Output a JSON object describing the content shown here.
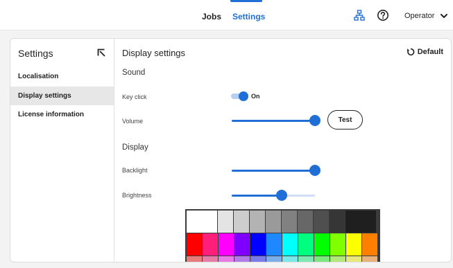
{
  "header": {
    "tabs": [
      {
        "label": "Jobs",
        "active": false
      },
      {
        "label": "Settings",
        "active": true
      }
    ],
    "icons": {
      "network": "network-icon",
      "help": "help-icon",
      "menu": "chevron-down-icon"
    },
    "user": "Operator"
  },
  "sidebar": {
    "title": "Settings",
    "collapse_icon": "collapse-arrow-icon",
    "items": [
      {
        "label": "Localisation",
        "active": false
      },
      {
        "label": "Display settings",
        "active": true
      },
      {
        "label": "License information",
        "active": false
      }
    ]
  },
  "main": {
    "title": "Display settings",
    "default_label": "Default",
    "default_icon": "reset-icon",
    "sound": {
      "heading": "Sound",
      "key_click_label": "Key click",
      "key_click_state": "On",
      "key_click_on": true,
      "volume_label": "Volume",
      "volume_fraction": 1.0,
      "test_label": "Test"
    },
    "display": {
      "heading": "Display",
      "backlight_label": "Backlight",
      "backlight_fraction": 1.0,
      "brightness_label": "Brightness",
      "brightness_fraction": 0.6
    },
    "palette": {
      "gray_row": [
        "#ffffff",
        "#e4e4e4",
        "#cdcdcd",
        "#b3b3b3",
        "#9a9a9a",
        "#818181",
        "#676767",
        "#4f4f4f",
        "#363636",
        "#1f1f1f"
      ],
      "color_row": [
        "#ff0000",
        "#ff1f7a",
        "#ff00ff",
        "#8000ff",
        "#0000ff",
        "#1e88ff",
        "#00ffff",
        "#00ff7f",
        "#00ff00",
        "#80ff00",
        "#ffff00",
        "#ff8000"
      ],
      "tint_row": [
        "#e87a7a",
        "#e87aa8",
        "#e87ae8",
        "#b07ae8",
        "#7a7ae8",
        "#7aaee8",
        "#7ae8e8",
        "#7ae8b0",
        "#7ae87a",
        "#b0e87a",
        "#e8e87a",
        "#e8b07a"
      ]
    },
    "colors": {
      "accent": "#1f6fd6",
      "accent_light": "#cfe0f6",
      "active_bg": "#e7e7e7"
    }
  }
}
